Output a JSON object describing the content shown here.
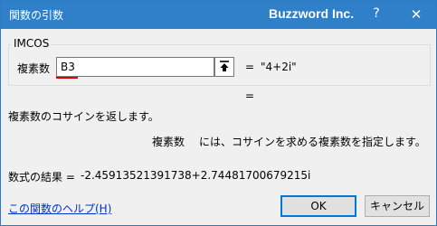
{
  "titlebar": {
    "title": "関数の引数",
    "app_name": "Buzzword Inc.",
    "help_glyph": "?",
    "close_glyph": "✕"
  },
  "function_group": {
    "name": "IMCOS",
    "argument": {
      "label": "複素数",
      "value": "B3",
      "equals": "=",
      "evaluated": "\"4+2i\""
    },
    "result_equals": "="
  },
  "description": {
    "function_text": "複素数のコサインを返します。",
    "argument_name": "複素数",
    "argument_text": "には、コサインを求める複素数を指定します。"
  },
  "formula_result": {
    "label": "数式の結果 =",
    "value": "-2.45913521391738+2.74481700679215i"
  },
  "footer": {
    "help_link": "この関数のヘルプ(H)",
    "ok_label": "OK",
    "cancel_label": "キャンセル"
  },
  "colors": {
    "titlebar": "#2f80c8",
    "link": "#0033cc",
    "underline": "#e00000",
    "ok_border": "#0078d7"
  },
  "icons": {
    "collapse": "collapse-dialog-icon",
    "close": "close-icon"
  }
}
